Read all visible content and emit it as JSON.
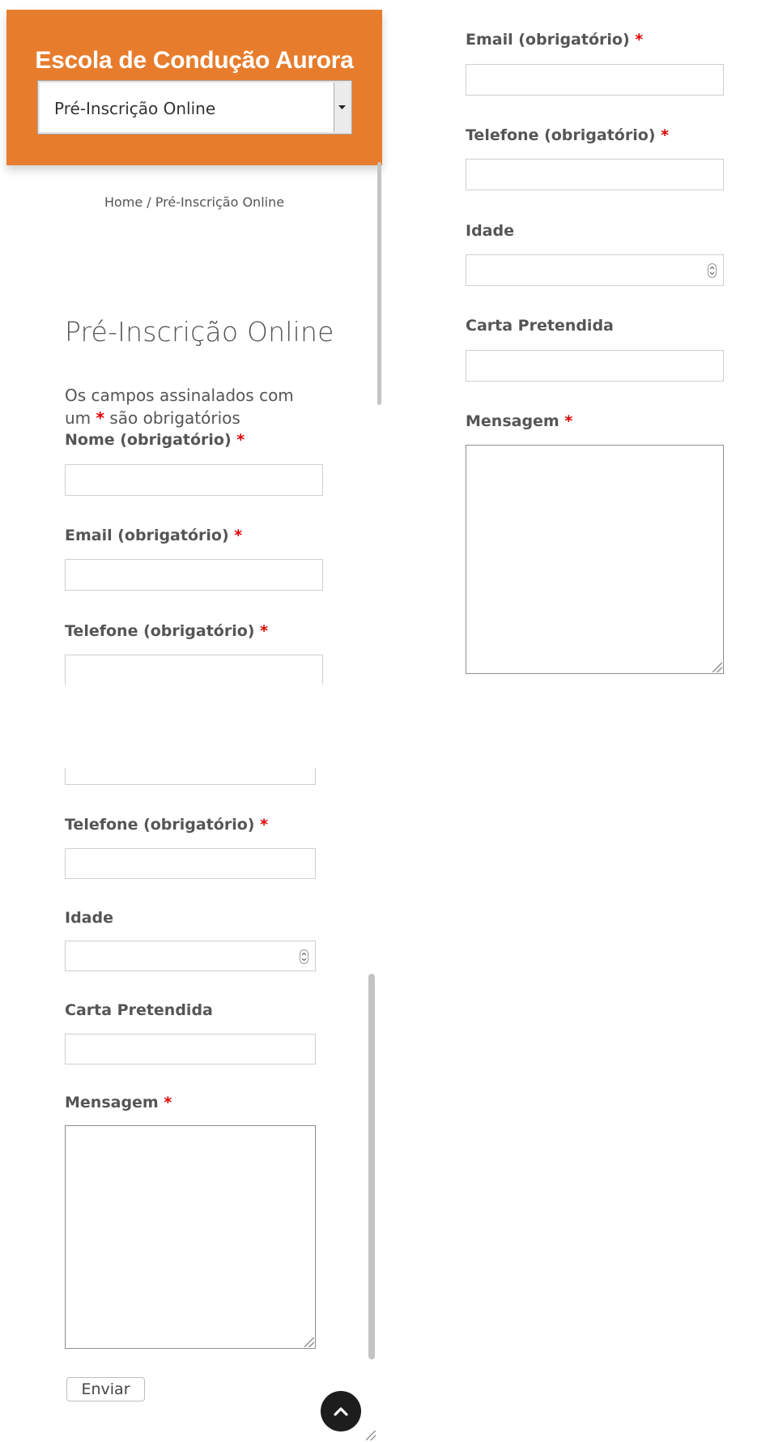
{
  "header": {
    "site_title": "Escola de Condução Aurora",
    "nav_select_value": "Pré-Inscrição Online",
    "nav_select_arrow": "▾"
  },
  "breadcrumb": {
    "home": "Home",
    "separator": " / ",
    "current": "Pré-Inscrição Online"
  },
  "page": {
    "title": "Pré-Inscrição Online",
    "required_note_before": "Os campos assinalados com um ",
    "required_note_star": "*",
    "required_note_after": " são obrigatórios"
  },
  "form": {
    "required_marker": "*",
    "name_label": "Nome (obrigatório)",
    "email_label": "Email (obrigatório)",
    "phone_label": "Telefone (obrigatório)",
    "age_label": "Idade",
    "license_label": "Carta Pretendida",
    "message_label": "Mensagem",
    "submit_label": "Enviar"
  },
  "icons": {
    "spin": "⌃⌄",
    "back_to_top": "chevron-up-icon"
  },
  "colors": {
    "brand_orange": "#e77c2c",
    "required_red": "#e10000",
    "back_to_top_bg": "#1d1d1d"
  }
}
